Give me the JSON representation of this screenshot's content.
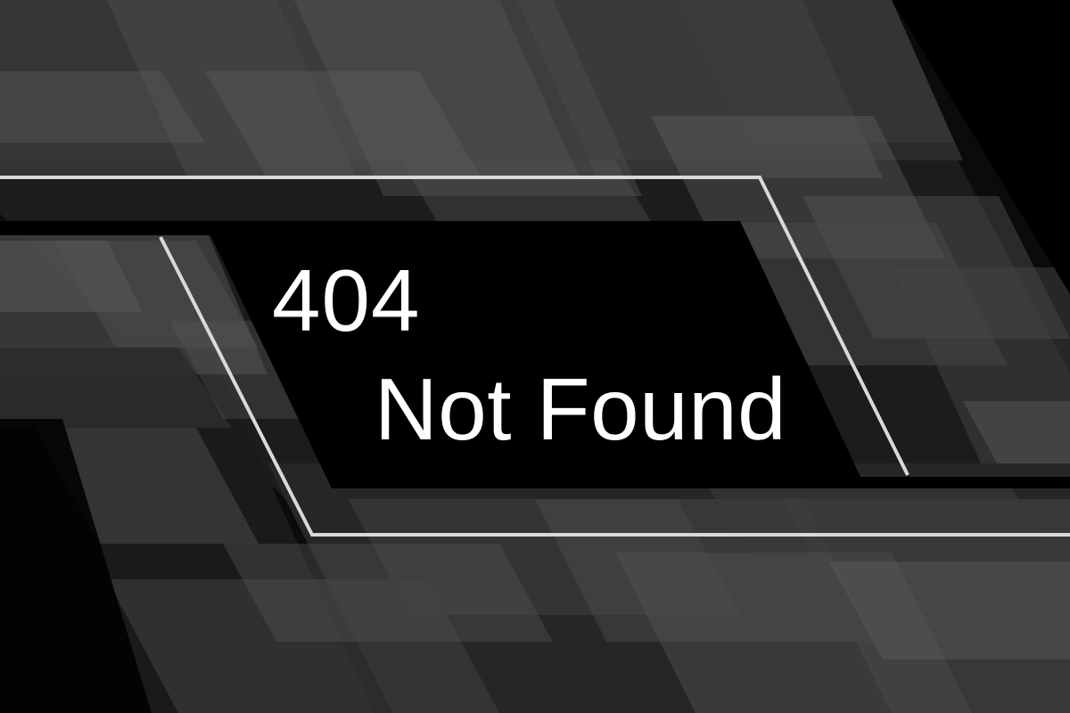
{
  "error": {
    "code": "404",
    "message": "Not Found"
  },
  "colors": {
    "background": "#0b0b0b",
    "panel": "#000000",
    "outline": "#d9d9d9",
    "text": "#ffffff"
  }
}
